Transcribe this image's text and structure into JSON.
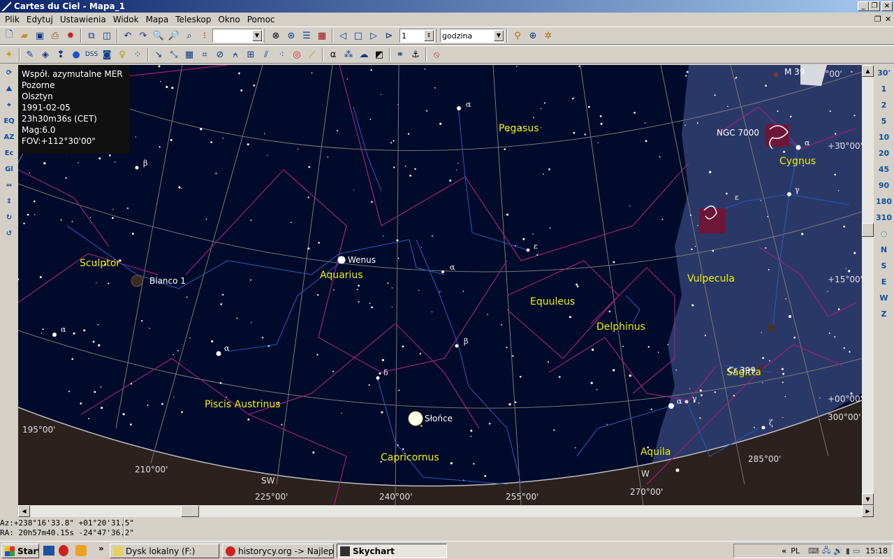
{
  "window": {
    "title": "Cartes du Ciel - Mapa_1"
  },
  "menu": [
    "Plik",
    "Edytuj",
    "Ustawienia",
    "Widok",
    "Mapa",
    "Teleskop",
    "Okno",
    "Pomoc"
  ],
  "toolbar": {
    "spin_value": "1",
    "time_unit": "godzina",
    "combo_value": ""
  },
  "info_panel": {
    "projection": "Współ. azymutalne MER",
    "mode": "Pozorne",
    "location": "Olsztyn",
    "date": "1991-02-05",
    "time": "23h30m36s (CET)",
    "magnitude": "Mag:6.0",
    "fov": "FOV:+112°30'00\""
  },
  "left_tools": [
    "EQ",
    "AZ",
    "Ec",
    "Gl"
  ],
  "right_tools": {
    "fov_presets": [
      "30'",
      "1",
      "2",
      "5",
      "10",
      "20",
      "45",
      "90",
      "180",
      "310"
    ],
    "directions": [
      "N",
      "S",
      "E",
      "W",
      "Z"
    ]
  },
  "chart": {
    "constellations": [
      "Pegasus",
      "Cygnus",
      "Sculptor",
      "Aquarius",
      "Equuleus",
      "Delphinus",
      "Vulpecula",
      "Sagitta",
      "Piscis Austrinus",
      "Capricornus",
      "Aquila"
    ],
    "objects": [
      "Wenus",
      "Słońce",
      "Blanco 1",
      "NGC 7000",
      "M 39",
      "Cr 399"
    ],
    "azimuth_labels": [
      "195°00'",
      "210°00'",
      "225°00'",
      "240°00'",
      "255°00'",
      "270°00'",
      "285°00'",
      "300°00'"
    ],
    "altitude_labels": [
      "+30°00'",
      "+15°00'",
      "+00°00'",
      "35°00'"
    ],
    "cardinals": [
      "SW",
      "W"
    ],
    "greek": [
      "α",
      "β",
      "ε",
      "δ",
      "γ",
      "ζ"
    ]
  },
  "status": {
    "azalt": "Az:+238°16'33.8\" +01°20'31.5\"",
    "radec": "RA: 20h57m40.15s -24°47'36.2\""
  },
  "taskbar": {
    "start": "Start",
    "quicklaunch_more": "»",
    "tasks": [
      "Dysk lokalny (F:)",
      "historycy.org -> Najleps...",
      "Skychart"
    ],
    "collapse": "«",
    "language": "PL",
    "clock": "15:18"
  }
}
